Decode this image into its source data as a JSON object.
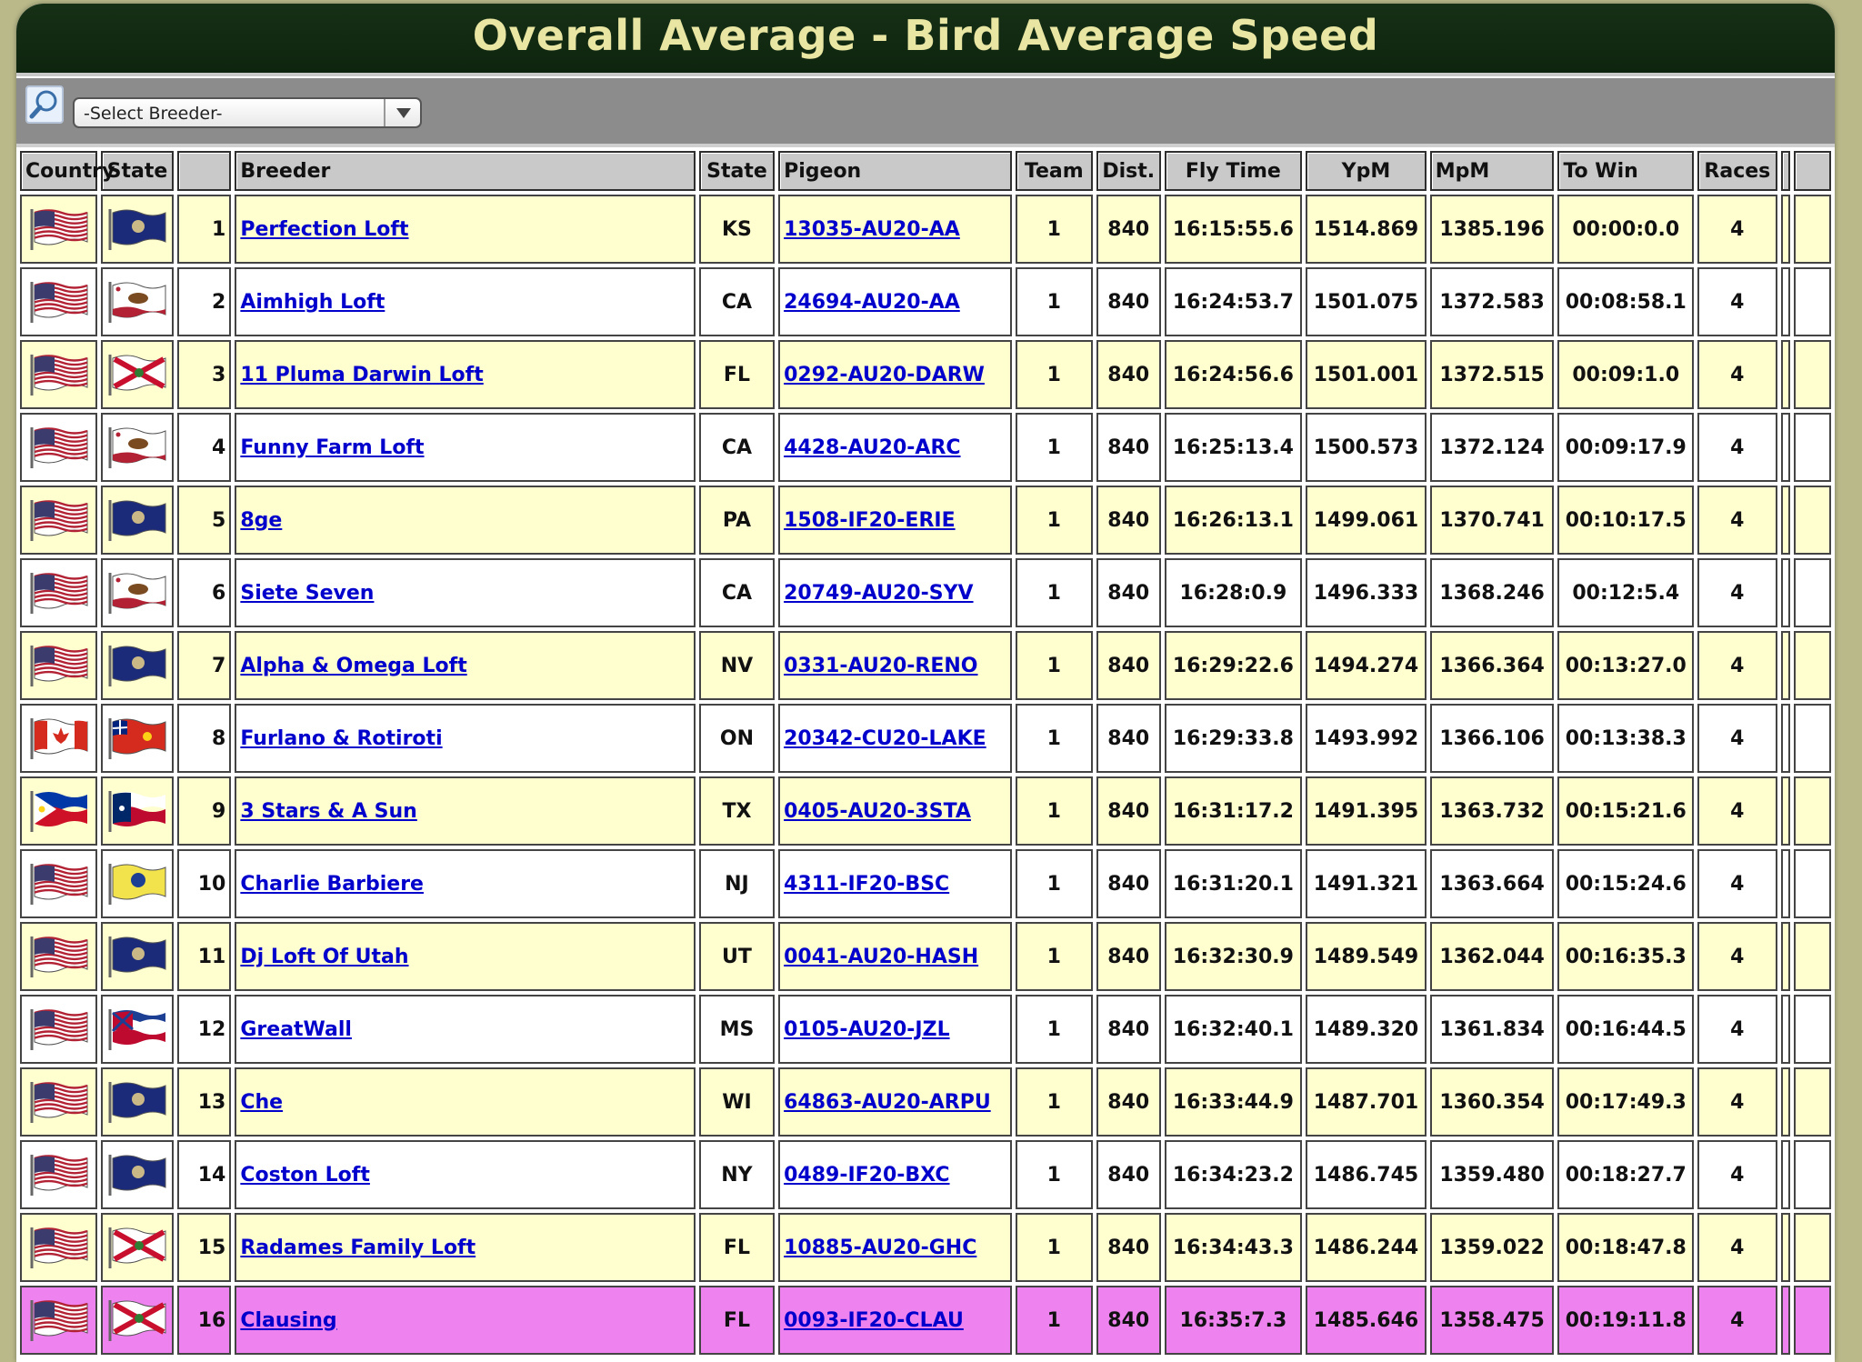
{
  "page": {
    "title": "Overall Average - Bird Average Speed"
  },
  "toolbar": {
    "select_value": "-Select Breeder-"
  },
  "headers": [
    "Country",
    "State",
    "",
    "Breeder",
    "State",
    "Pigeon",
    "Team",
    "Dist.",
    "Fly Time",
    "YpM",
    "MpM",
    "To Win",
    "Races",
    "",
    ""
  ],
  "flags": {
    "us": {
      "colors": [
        "#b22234",
        "#ffffff",
        "#3c3b6e"
      ]
    },
    "ca": {
      "colors": [
        "#d52b1e",
        "#ffffff"
      ]
    },
    "ph": {
      "colors": [
        "#0038a8",
        "#ce1126",
        "#ffffff",
        "#fcd116"
      ]
    }
  },
  "rows": [
    {
      "rank": "1",
      "country": "us",
      "state_flag": "state-flag-ks",
      "breeder": "Perfection Loft",
      "state": "KS",
      "pigeon": "13035-AU20-AA",
      "team": "1",
      "dist": "840",
      "fly_time": "16:15:55.6",
      "ypm": "1514.869",
      "mpm": "1385.196",
      "to_win": "00:00:0.0",
      "races": "4"
    },
    {
      "rank": "2",
      "country": "us",
      "state_flag": "state-flag-ca",
      "breeder": "Aimhigh Loft",
      "state": "CA",
      "pigeon": "24694-AU20-AA",
      "team": "1",
      "dist": "840",
      "fly_time": "16:24:53.7",
      "ypm": "1501.075",
      "mpm": "1372.583",
      "to_win": "00:08:58.1",
      "races": "4"
    },
    {
      "rank": "3",
      "country": "us",
      "state_flag": "state-flag-fl",
      "breeder": "11 Pluma Darwin Loft",
      "state": "FL",
      "pigeon": "0292-AU20-DARW",
      "team": "1",
      "dist": "840",
      "fly_time": "16:24:56.6",
      "ypm": "1501.001",
      "mpm": "1372.515",
      "to_win": "00:09:1.0",
      "races": "4"
    },
    {
      "rank": "4",
      "country": "us",
      "state_flag": "state-flag-ca",
      "breeder": "Funny Farm Loft",
      "state": "CA",
      "pigeon": "4428-AU20-ARC",
      "team": "1",
      "dist": "840",
      "fly_time": "16:25:13.4",
      "ypm": "1500.573",
      "mpm": "1372.124",
      "to_win": "00:09:17.9",
      "races": "4"
    },
    {
      "rank": "5",
      "country": "us",
      "state_flag": "state-flag-pa",
      "breeder": "8ge",
      "state": "PA",
      "pigeon": "1508-IF20-ERIE",
      "team": "1",
      "dist": "840",
      "fly_time": "16:26:13.1",
      "ypm": "1499.061",
      "mpm": "1370.741",
      "to_win": "00:10:17.5",
      "races": "4"
    },
    {
      "rank": "6",
      "country": "us",
      "state_flag": "state-flag-ca",
      "breeder": "Siete Seven",
      "state": "CA",
      "pigeon": "20749-AU20-SYV",
      "team": "1",
      "dist": "840",
      "fly_time": "16:28:0.9",
      "ypm": "1496.333",
      "mpm": "1368.246",
      "to_win": "00:12:5.4",
      "races": "4"
    },
    {
      "rank": "7",
      "country": "us",
      "state_flag": "state-flag-nv",
      "breeder": "Alpha & Omega Loft",
      "state": "NV",
      "pigeon": "0331-AU20-RENO",
      "team": "1",
      "dist": "840",
      "fly_time": "16:29:22.6",
      "ypm": "1494.274",
      "mpm": "1366.364",
      "to_win": "00:13:27.0",
      "races": "4"
    },
    {
      "rank": "8",
      "country": "ca",
      "state_flag": "state-flag-on",
      "breeder": "Furlano & Rotiroti",
      "state": "ON",
      "pigeon": "20342-CU20-LAKE",
      "team": "1",
      "dist": "840",
      "fly_time": "16:29:33.8",
      "ypm": "1493.992",
      "mpm": "1366.106",
      "to_win": "00:13:38.3",
      "races": "4"
    },
    {
      "rank": "9",
      "country": "ph",
      "state_flag": "state-flag-tx",
      "breeder": "3 Stars & A Sun",
      "state": "TX",
      "pigeon": "0405-AU20-3STA",
      "team": "1",
      "dist": "840",
      "fly_time": "16:31:17.2",
      "ypm": "1491.395",
      "mpm": "1363.732",
      "to_win": "00:15:21.6",
      "races": "4"
    },
    {
      "rank": "10",
      "country": "us",
      "state_flag": "state-flag-nj",
      "breeder": "Charlie Barbiere",
      "state": "NJ",
      "pigeon": "4311-IF20-BSC",
      "team": "1",
      "dist": "840",
      "fly_time": "16:31:20.1",
      "ypm": "1491.321",
      "mpm": "1363.664",
      "to_win": "00:15:24.6",
      "races": "4"
    },
    {
      "rank": "11",
      "country": "us",
      "state_flag": "state-flag-ut",
      "breeder": "Dj Loft Of Utah",
      "state": "UT",
      "pigeon": "0041-AU20-HASH",
      "team": "1",
      "dist": "840",
      "fly_time": "16:32:30.9",
      "ypm": "1489.549",
      "mpm": "1362.044",
      "to_win": "00:16:35.3",
      "races": "4"
    },
    {
      "rank": "12",
      "country": "us",
      "state_flag": "state-flag-ms",
      "breeder": "GreatWall",
      "state": "MS",
      "pigeon": "0105-AU20-JZL",
      "team": "1",
      "dist": "840",
      "fly_time": "16:32:40.1",
      "ypm": "1489.320",
      "mpm": "1361.834",
      "to_win": "00:16:44.5",
      "races": "4"
    },
    {
      "rank": "13",
      "country": "us",
      "state_flag": "state-flag-wi",
      "breeder": "Che",
      "state": "WI",
      "pigeon": "64863-AU20-ARPU",
      "team": "1",
      "dist": "840",
      "fly_time": "16:33:44.9",
      "ypm": "1487.701",
      "mpm": "1360.354",
      "to_win": "00:17:49.3",
      "races": "4"
    },
    {
      "rank": "14",
      "country": "us",
      "state_flag": "state-flag-ny",
      "breeder": "Coston Loft",
      "state": "NY",
      "pigeon": "0489-IF20-BXC",
      "team": "1",
      "dist": "840",
      "fly_time": "16:34:23.2",
      "ypm": "1486.745",
      "mpm": "1359.480",
      "to_win": "00:18:27.7",
      "races": "4"
    },
    {
      "rank": "15",
      "country": "us",
      "state_flag": "state-flag-fl",
      "breeder": "Radames Family Loft",
      "state": "FL",
      "pigeon": "10885-AU20-GHC",
      "team": "1",
      "dist": "840",
      "fly_time": "16:34:43.3",
      "ypm": "1486.244",
      "mpm": "1359.022",
      "to_win": "00:18:47.8",
      "races": "4"
    },
    {
      "rank": "16",
      "country": "us",
      "state_flag": "state-flag-fl",
      "breeder": "Clausing",
      "state": "FL",
      "pigeon": "0093-IF20-CLAU",
      "team": "1",
      "dist": "840",
      "fly_time": "16:35:7.3",
      "ypm": "1485.646",
      "mpm": "1358.475",
      "to_win": "00:19:11.8",
      "races": "4",
      "highlighted": true
    }
  ],
  "colors": {
    "row_odd": "#ffffd0",
    "row_even": "#ffffff",
    "row_highlight": "#ee82ee",
    "title_bar": "#163016",
    "title_text": "#e9e5a3",
    "link": "#0000cc"
  }
}
